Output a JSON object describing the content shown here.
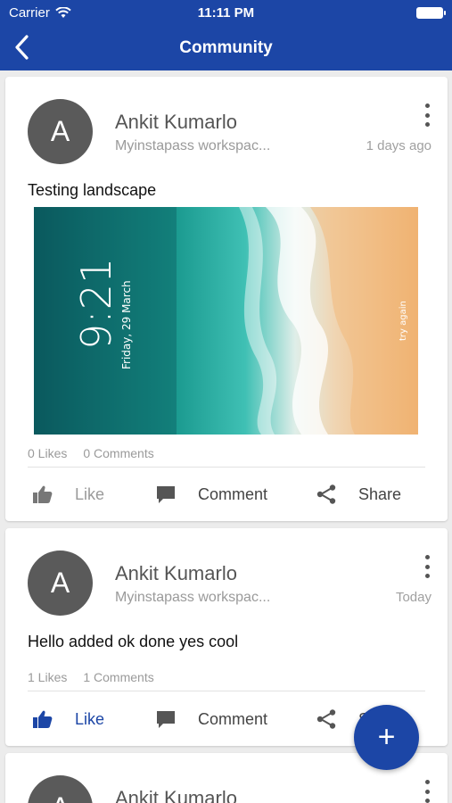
{
  "status": {
    "carrier": "Carrier",
    "time": "11:11 PM"
  },
  "nav": {
    "title": "Community"
  },
  "posts": [
    {
      "avatar_initial": "A",
      "author": "Ankit Kumarlo",
      "workspace": "Myinstapass workspac...",
      "time": "1 days ago",
      "text": "Testing landscape",
      "image_text": {
        "clock": "9:21",
        "date": "Friday, 29 March",
        "side": "try again"
      },
      "likes": "0 Likes",
      "comments": "0 Comments",
      "like_label": "Like",
      "comment_label": "Comment",
      "share_label": "Share"
    },
    {
      "avatar_initial": "A",
      "author": "Ankit Kumarlo",
      "workspace": "Myinstapass workspac...",
      "time": "Today",
      "text": "Hello added ok done yes cool",
      "likes": "1 Likes",
      "comments": "1 Comments",
      "like_label": "Like",
      "comment_label": "Comment",
      "share_label": "Sh"
    },
    {
      "avatar_initial": "A",
      "author": "Ankit Kumarlo"
    }
  ],
  "fab": {
    "label": "+"
  },
  "colors": {
    "primary": "#1c46a6",
    "avatar": "#5a5a5a",
    "background": "#ececec"
  }
}
